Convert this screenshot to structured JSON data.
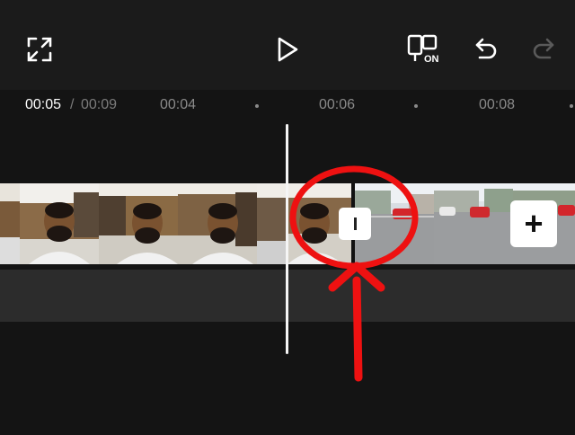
{
  "toolbar": {
    "fullscreen_icon": "expand-icon",
    "play_icon": "play-icon",
    "main_track_icon": "main-track-magnet-icon",
    "main_track_badge": "ON",
    "undo_icon": "undo-icon",
    "redo_icon": "redo-icon"
  },
  "ruler": {
    "current_time": "00:05",
    "separator": "/",
    "total_time": "00:09",
    "ticks": [
      "00:04",
      "00:06",
      "00:08"
    ]
  },
  "clips": {
    "clip1_description": "selfie video",
    "clip2_description": "street video"
  },
  "transition_button": {
    "icon": "transition-icon"
  },
  "add_clip_button": {
    "label": "+"
  },
  "colors": {
    "background": "#1b1b1b",
    "annotation": "#ee1111",
    "playhead": "#f5f5f5"
  }
}
